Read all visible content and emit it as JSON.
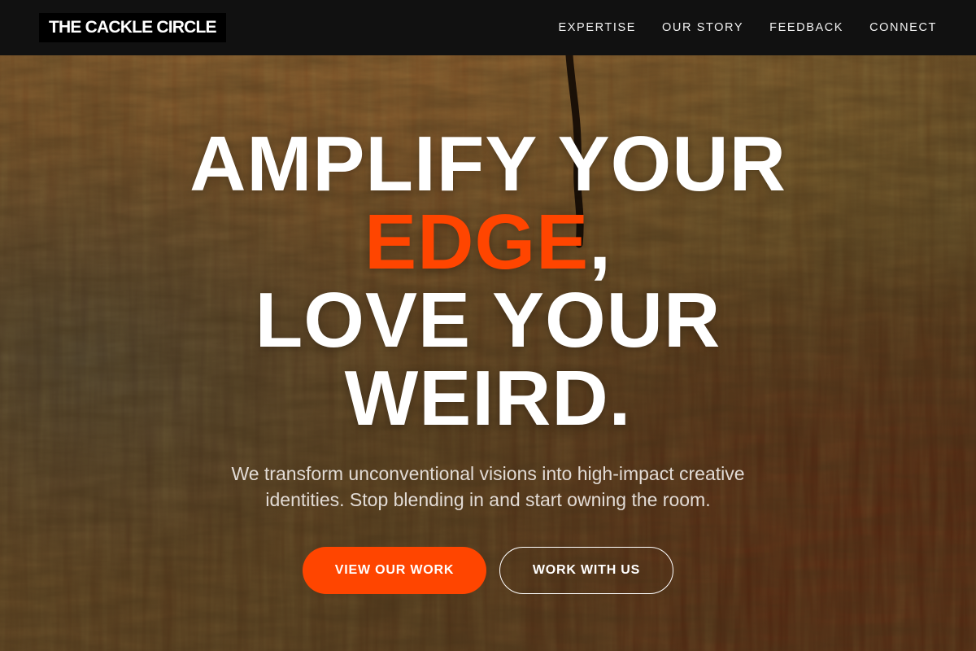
{
  "brand": {
    "name": "THE CACKLE CIRCLE"
  },
  "nav": {
    "items": [
      {
        "label": "EXPERTISE"
      },
      {
        "label": "OUR STORY"
      },
      {
        "label": "FEEDBACK"
      },
      {
        "label": "CONNECT"
      }
    ]
  },
  "hero": {
    "headline": {
      "line1": "AMPLIFY YOUR",
      "accent_word": "EDGE",
      "comma": ",",
      "line3": "LOVE YOUR",
      "line4": "WEIRD."
    },
    "subtext": "We transform unconventional visions into high-impact creative identities. Stop blending in and start owning the room.",
    "primary_cta": "VIEW OUR WORK",
    "secondary_cta": "WORK WITH US"
  },
  "colors": {
    "accent": "#ff4500",
    "navbar": "#111111",
    "text": "#ffffff"
  }
}
